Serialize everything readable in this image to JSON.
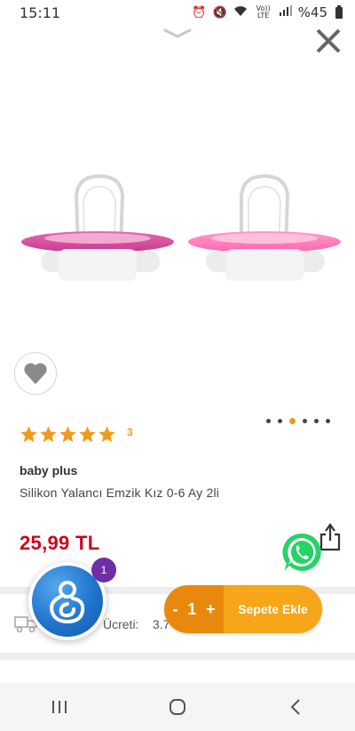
{
  "status_bar": {
    "time": "15:11",
    "network_label": "Vo)) LTE",
    "battery": "%45"
  },
  "icons": {
    "collapse": "chevron-down-icon",
    "close": "close-icon",
    "favorite": "heart-icon",
    "share": "share-icon",
    "whatsapp": "whatsapp-icon",
    "shipping": "truck-icon",
    "assistant": "assistant-logo-icon",
    "nav_recents": "recents-icon",
    "nav_home": "home-icon",
    "nav_back": "back-icon"
  },
  "carousel": {
    "count": 6,
    "active_index": 2
  },
  "product": {
    "rating": 5,
    "rating_count": "3",
    "brand": "baby plus",
    "name": "Silikon Yalancı Emzik Kız 0-6 Ay 2li",
    "price": "25,99 TL"
  },
  "shipping": {
    "label": "Ücreti:",
    "value": "3.7"
  },
  "assistant": {
    "notification_count": "1"
  },
  "cart": {
    "minus_label": "-",
    "quantity": "1",
    "plus_label": "+",
    "add_label": "Sepete Ekle"
  },
  "colors": {
    "accent_orange": "#f7a61a",
    "qty_orange": "#e8890d",
    "price_red": "#d0021b",
    "star_orange": "#f19a1b",
    "badge_purple": "#6f2da8",
    "whatsapp_green": "#25d366"
  }
}
